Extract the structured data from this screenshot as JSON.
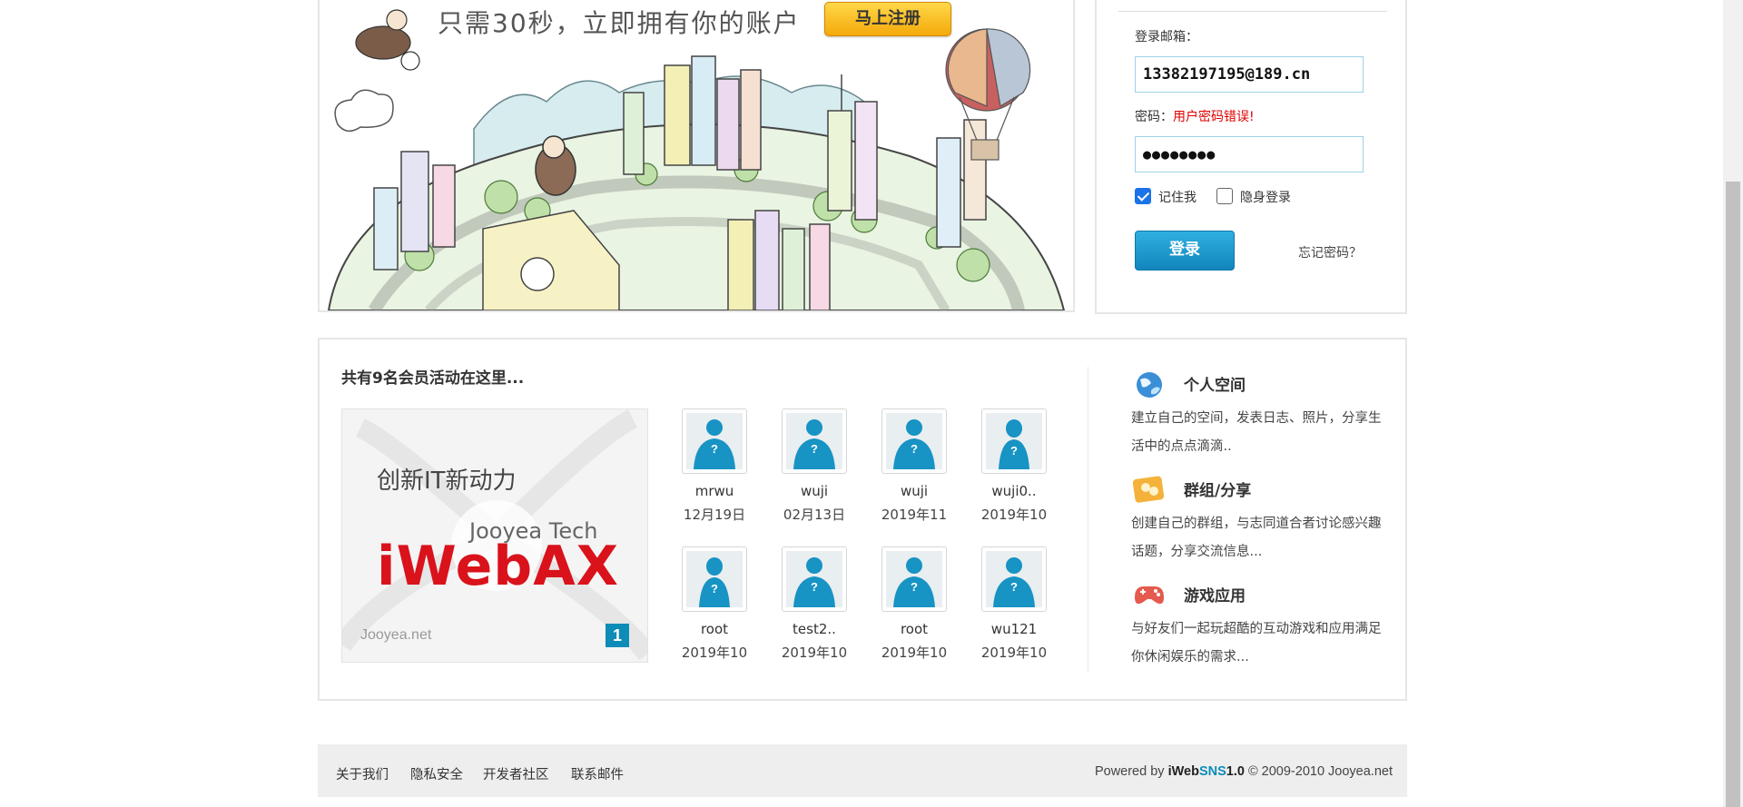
{
  "banner": {
    "tagline": "只需30秒，立即拥有你的账户",
    "register_button": "马上注册"
  },
  "login": {
    "email_label": "登录邮箱：",
    "email_value": "13382197195@189.cn",
    "password_label": "密码：",
    "password_error": "用户密码错误!",
    "password_mask": "●●●●●●●●",
    "remember_label": "记住我",
    "remember_checked": true,
    "invisible_label": "隐身登录",
    "invisible_checked": false,
    "submit_label": "登录",
    "forgot_label": "忘记密码？"
  },
  "members": {
    "title": "共有9名会员活动在这里...",
    "ad": {
      "slogan": "创新IT新动力",
      "company": "Jooyea Tech",
      "logo": "iWebAX",
      "site": "Jooyea.net",
      "page_number": "1"
    },
    "list": [
      {
        "name": "mrwu",
        "date": "12月19日",
        "avatar": "male-avatar-icon"
      },
      {
        "name": "wuji",
        "date": "02月13日",
        "avatar": "male-avatar-icon"
      },
      {
        "name": "wuji",
        "date": "2019年11",
        "avatar": "male-avatar-icon"
      },
      {
        "name": "wuji0..",
        "date": "2019年10",
        "avatar": "female-avatar-icon"
      },
      {
        "name": "root",
        "date": "2019年10",
        "avatar": "female-avatar-icon"
      },
      {
        "name": "test2..",
        "date": "2019年10",
        "avatar": "male-avatar-icon"
      },
      {
        "name": "root",
        "date": "2019年10",
        "avatar": "male-avatar-icon"
      },
      {
        "name": "wu121",
        "date": "2019年10",
        "avatar": "male-avatar-icon"
      }
    ]
  },
  "features": [
    {
      "title": "个人空间",
      "desc": "建立自己的空间，发表日志、照片，分享生活中的点点滴滴..",
      "icon": "globe-icon"
    },
    {
      "title": "群组/分享",
      "desc": "创建自己的群组，与志同道合者讨论感兴趣话题，分享交流信息...",
      "icon": "group-icon"
    },
    {
      "title": "游戏应用",
      "desc": "与好友们一起玩超酷的互动游戏和应用满足你休闲娱乐的需求...",
      "icon": "gamepad-icon"
    }
  ],
  "footer": {
    "links": [
      "关于我们",
      "隐私安全",
      "开发者社区",
      "联系邮件"
    ],
    "powered_prefix": "Powered by ",
    "brand_iweb": "iWeb",
    "brand_sns": "SNS",
    "brand_version": "1.0",
    "copyright": " © 2009-2010 Jooyea.net"
  },
  "colors": {
    "accent": "#1285bd",
    "error": "#e00000",
    "register": "#f4a90a",
    "ad_logo": "#d9121b"
  }
}
